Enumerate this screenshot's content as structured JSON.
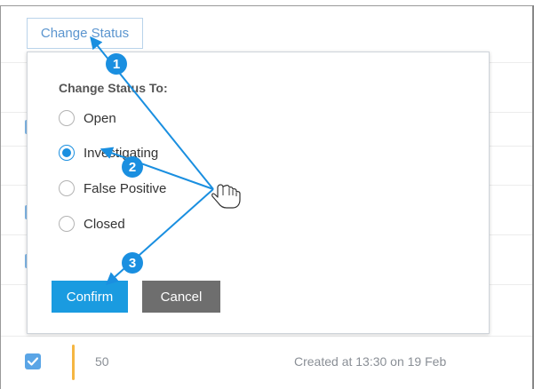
{
  "toolbar": {
    "change_status_label": "Change Status"
  },
  "dialog": {
    "title": "Change Status To:",
    "options": [
      {
        "label": "Open",
        "selected": false
      },
      {
        "label": "Investigating",
        "selected": true
      },
      {
        "label": "False Positive",
        "selected": false
      },
      {
        "label": "Closed",
        "selected": false
      }
    ],
    "confirm_label": "Confirm",
    "cancel_label": "Cancel"
  },
  "table": {
    "visible_row": {
      "checked": true,
      "number": "50",
      "created": "Created at 13:30 on 19 Feb",
      "severity_color": "#f5b642"
    }
  },
  "annotations": {
    "steps": [
      "1",
      "2",
      "3"
    ],
    "pointer_icon": "hand-pointer-icon",
    "accent_color": "#1a8fe0"
  },
  "colors": {
    "primary": "#1a9be0",
    "secondary": "#6e6e6e",
    "link": "#5b95cf"
  }
}
